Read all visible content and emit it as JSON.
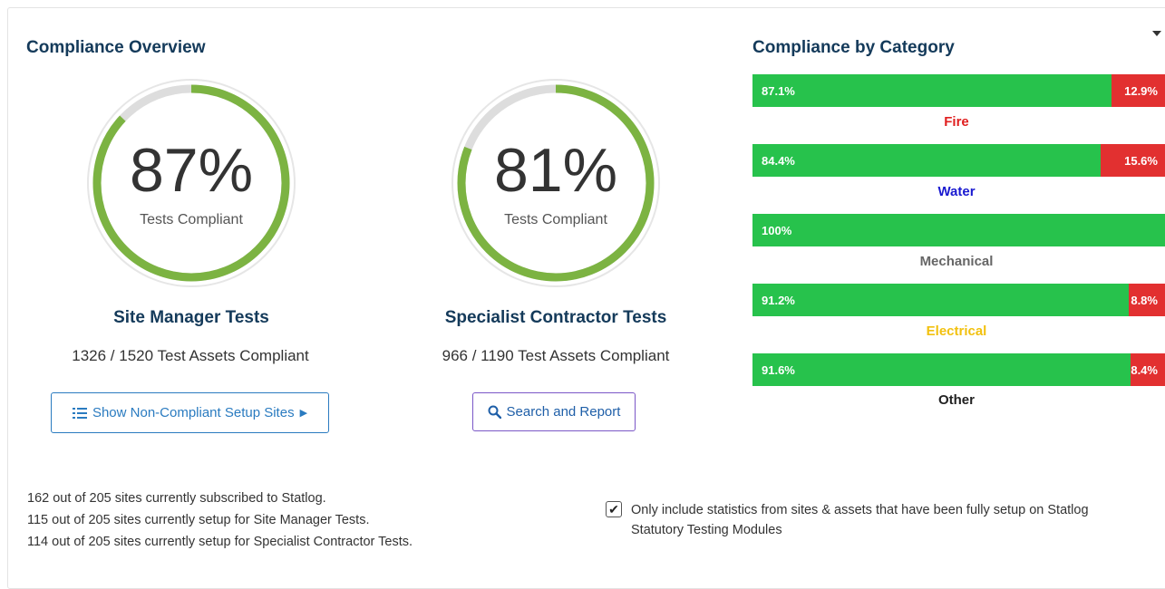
{
  "overview": {
    "heading": "Compliance Overview",
    "gauges": [
      {
        "percent": 87,
        "percent_label": "87%",
        "sub": "Tests Compliant",
        "title": "Site Manager Tests",
        "count": "1326 / 1520 Test Assets Compliant",
        "button_label": "Show Non-Compliant Setup Sites",
        "button_icon": "list-icon",
        "ring_color": "#7cb342",
        "track_color": "#dddddd"
      },
      {
        "percent": 81,
        "percent_label": "81%",
        "sub": "Tests Compliant",
        "title": "Specialist Contractor Tests",
        "count": "966 / 1190 Test Assets Compliant",
        "button_label": "Search and Report",
        "button_icon": "search-icon",
        "ring_color": "#7cb342",
        "track_color": "#dddddd"
      }
    ]
  },
  "category": {
    "heading": "Compliance by Category",
    "items": [
      {
        "name": "Fire",
        "compliant": 87.1,
        "compliant_label": "87.1%",
        "noncompliant_label": "12.9%",
        "label_color": "#e02020"
      },
      {
        "name": "Water",
        "compliant": 84.4,
        "compliant_label": "84.4%",
        "noncompliant_label": "15.6%",
        "label_color": "#1a1ad0"
      },
      {
        "name": "Mechanical",
        "compliant": 100,
        "compliant_label": "100%",
        "noncompliant_label": "",
        "label_color": "#666666"
      },
      {
        "name": "Electrical",
        "compliant": 91.2,
        "compliant_label": "91.2%",
        "noncompliant_label": "8.8%",
        "label_color": "#f2c10f"
      },
      {
        "name": "Other",
        "compliant": 91.6,
        "compliant_label": "91.6%",
        "noncompliant_label": "8.4%",
        "label_color": "#222222"
      }
    ]
  },
  "stats": [
    "162 out of 205 sites currently subscribed to Statlog.",
    "115 out of 205 sites currently setup for Site Manager Tests.",
    "114 out of 205 sites currently setup for Specialist Contractor Tests."
  ],
  "filter": {
    "checked": true,
    "label": "Only include statistics from sites & assets that have been fully setup on Statlog Statutory Testing Modules"
  },
  "colors": {
    "green": "#27c24c",
    "red": "#e23030",
    "heading": "#143a5a"
  }
}
